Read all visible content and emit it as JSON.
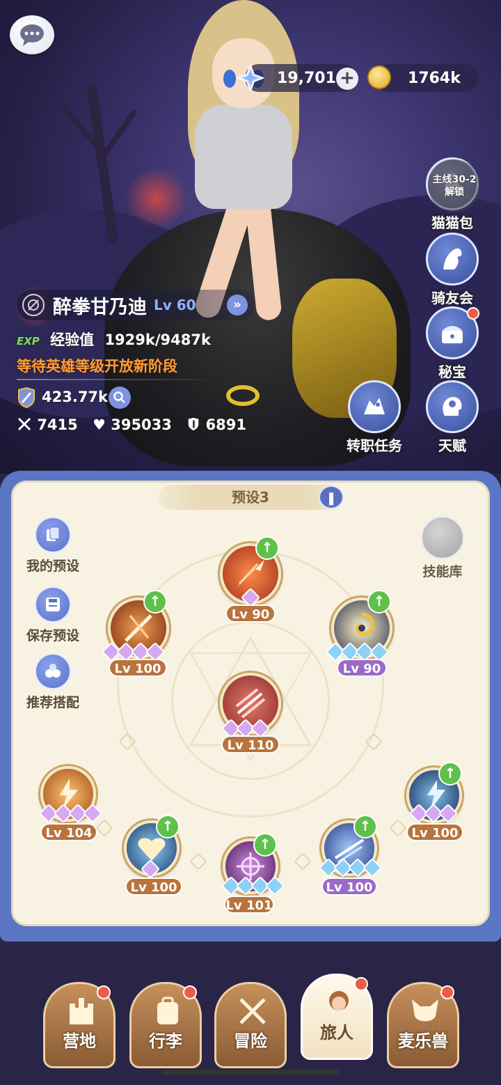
{
  "resources": {
    "gems": "19,701",
    "gold": "1764k"
  },
  "side_menu": [
    {
      "name": "猫猫包",
      "locked_text": "主线30-2\n解锁",
      "lock_line1": "主线30-2",
      "lock_line2": "解锁"
    },
    {
      "name": "骑友会"
    },
    {
      "name": "秘宝"
    },
    {
      "name": "天赋"
    }
  ],
  "job_quest": "转职任务",
  "hero": {
    "name": "醉拳甘乃迪",
    "level": "Lv 60",
    "exp_tag": "EXP",
    "exp_label": "经验值",
    "exp_value": "1929k/9487k",
    "notice": "等待英雄等级开放新阶段",
    "power": "423.77k",
    "attack": "7415",
    "hp": "395033",
    "defense": "6891"
  },
  "panel": {
    "preset_name": "预设3",
    "my_presets": "我的预设",
    "save_preset": "保存预设",
    "recommended": "推荐搭配",
    "skill_library": "技能库"
  },
  "skills": [
    {
      "level": "Lv 90"
    },
    {
      "level": "Lv 100"
    },
    {
      "level": "Lv 90"
    },
    {
      "level": "Lv 110"
    },
    {
      "level": "Lv 104"
    },
    {
      "level": "Lv 100"
    },
    {
      "level": "Lv 101"
    },
    {
      "level": "Lv 100"
    },
    {
      "level": "Lv 100"
    }
  ],
  "nav": [
    {
      "label": "营地"
    },
    {
      "label": "行李"
    },
    {
      "label": "冒险"
    },
    {
      "label": "旅人"
    },
    {
      "label": "麦乐兽"
    }
  ]
}
